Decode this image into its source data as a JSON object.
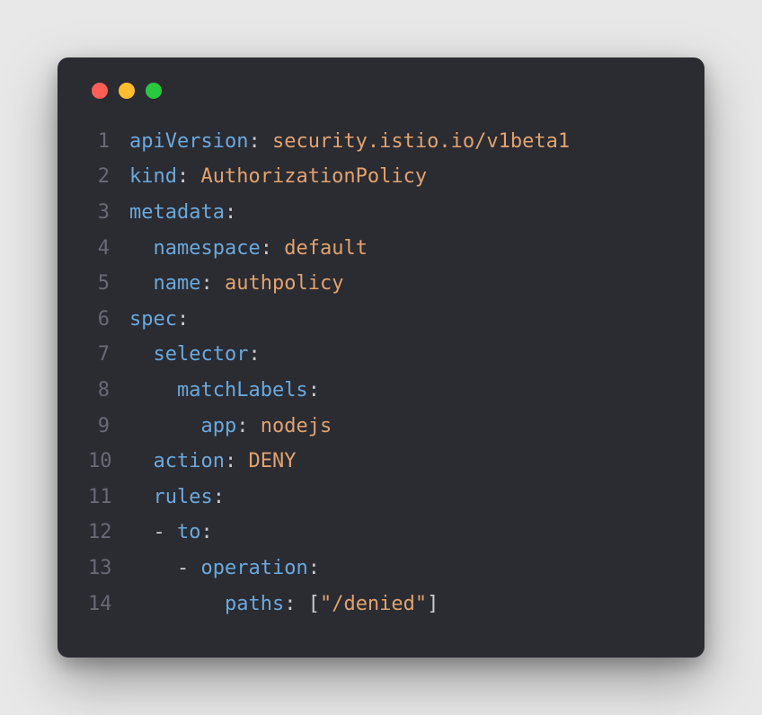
{
  "window": {
    "controls": [
      "close",
      "minimize",
      "zoom"
    ]
  },
  "code": {
    "lines": [
      {
        "num": "1",
        "indent": 0,
        "tokens": [
          {
            "t": "key",
            "v": "apiVersion"
          },
          {
            "t": "punc",
            "v": ": "
          },
          {
            "t": "str",
            "v": "security.istio.io/v1beta1"
          }
        ]
      },
      {
        "num": "2",
        "indent": 0,
        "tokens": [
          {
            "t": "key",
            "v": "kind"
          },
          {
            "t": "punc",
            "v": ": "
          },
          {
            "t": "str",
            "v": "AuthorizationPolicy"
          }
        ]
      },
      {
        "num": "3",
        "indent": 0,
        "tokens": [
          {
            "t": "key",
            "v": "metadata"
          },
          {
            "t": "punc",
            "v": ":"
          }
        ]
      },
      {
        "num": "4",
        "indent": 1,
        "tokens": [
          {
            "t": "key",
            "v": "namespace"
          },
          {
            "t": "punc",
            "v": ": "
          },
          {
            "t": "str",
            "v": "default"
          }
        ]
      },
      {
        "num": "5",
        "indent": 1,
        "tokens": [
          {
            "t": "key",
            "v": "name"
          },
          {
            "t": "punc",
            "v": ": "
          },
          {
            "t": "str",
            "v": "authpolicy"
          }
        ]
      },
      {
        "num": "6",
        "indent": 0,
        "tokens": [
          {
            "t": "key",
            "v": "spec"
          },
          {
            "t": "punc",
            "v": ":"
          }
        ]
      },
      {
        "num": "7",
        "indent": 1,
        "tokens": [
          {
            "t": "key",
            "v": "selector"
          },
          {
            "t": "punc",
            "v": ":"
          }
        ]
      },
      {
        "num": "8",
        "indent": 2,
        "tokens": [
          {
            "t": "key",
            "v": "matchLabels"
          },
          {
            "t": "punc",
            "v": ":"
          }
        ]
      },
      {
        "num": "9",
        "indent": 3,
        "tokens": [
          {
            "t": "key",
            "v": "app"
          },
          {
            "t": "punc",
            "v": ": "
          },
          {
            "t": "str",
            "v": "nodejs"
          }
        ]
      },
      {
        "num": "10",
        "indent": 1,
        "tokens": [
          {
            "t": "key",
            "v": "action"
          },
          {
            "t": "punc",
            "v": ": "
          },
          {
            "t": "str",
            "v": "DENY"
          }
        ]
      },
      {
        "num": "11",
        "indent": 1,
        "tokens": [
          {
            "t": "key",
            "v": "rules"
          },
          {
            "t": "punc",
            "v": ":"
          }
        ]
      },
      {
        "num": "12",
        "indent": 1,
        "tokens": [
          {
            "t": "punc",
            "v": "- "
          },
          {
            "t": "key",
            "v": "to"
          },
          {
            "t": "punc",
            "v": ":"
          }
        ]
      },
      {
        "num": "13",
        "indent": 2,
        "tokens": [
          {
            "t": "punc",
            "v": "- "
          },
          {
            "t": "key",
            "v": "operation"
          },
          {
            "t": "punc",
            "v": ":"
          }
        ]
      },
      {
        "num": "14",
        "indent": 4,
        "tokens": [
          {
            "t": "key",
            "v": "paths"
          },
          {
            "t": "punc",
            "v": ": ["
          },
          {
            "t": "str",
            "v": "\"/denied\""
          },
          {
            "t": "punc",
            "v": "]"
          }
        ]
      }
    ]
  }
}
